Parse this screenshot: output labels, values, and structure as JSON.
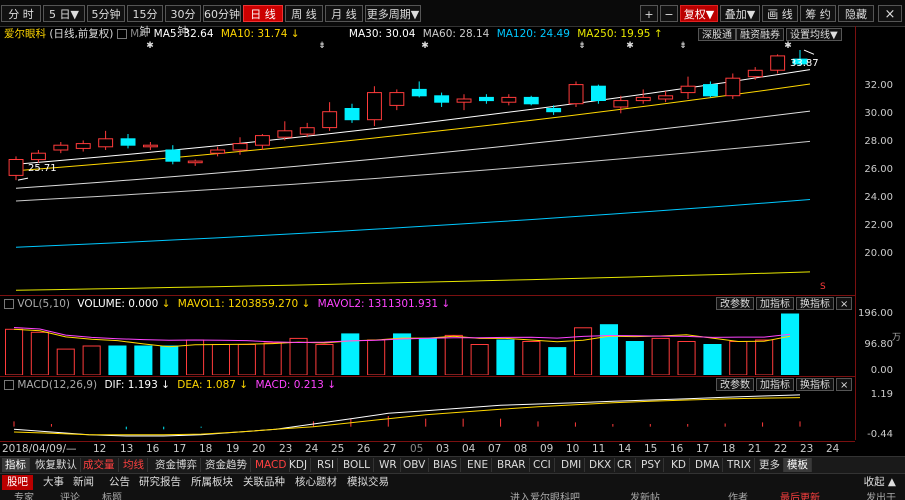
{
  "toolbar": {
    "periods": [
      "分 时",
      "5 日▼",
      "5分钟",
      "15分钟",
      "30分钟",
      "60分钟",
      "日 线",
      "周 线",
      "月 线",
      "更多周期▼"
    ],
    "active_period": "日 线",
    "right_buttons": [
      "+",
      "−",
      "复权▼",
      "叠加▼",
      "画 线",
      "筹 约",
      "隐藏"
    ],
    "close_icon": "×"
  },
  "price_panel": {
    "stock_name": "爱尔眼科",
    "mode": "(日线,前复权)",
    "ma_label": "MA",
    "ma5": "MA5: 32.64",
    "ma10": "MA10: 31.74",
    "ma30": "MA30: 30.04",
    "ma60": "MA60: 28.14",
    "ma120": "MA120: 24.49",
    "ma250": "MA250: 19.95",
    "buttons": [
      "深股通",
      "融资融券",
      "设置均线▼"
    ],
    "high_label": "33.87",
    "low_label": "25.71",
    "yaxis": [
      "32.00",
      "30.00",
      "28.00",
      "26.00",
      "24.00",
      "22.00",
      "20.00"
    ],
    "s_mark": "S"
  },
  "volume_panel": {
    "label": "VOL(5,10)",
    "volume": "VOLUME: 0.000",
    "mavol1": "MAVOL1: 1203859.270",
    "mavol2": "MAVOL2: 1311301.931",
    "buttons": [
      "改参数",
      "加指标",
      "换指标"
    ],
    "yaxis": [
      "196.00",
      "96.80",
      "0.00"
    ],
    "unit": "万"
  },
  "macd_panel": {
    "label": "MACD(12,26,9)",
    "dif": "DIF: 1.193",
    "dea": "DEA: 1.087",
    "macd": "MACD: 0.213",
    "buttons": [
      "改参数",
      "加指标",
      "换指标"
    ],
    "yaxis": [
      "1.19",
      "-0.44"
    ]
  },
  "dates": [
    "2018/04/09/—",
    "12",
    "13",
    "16",
    "17",
    "18",
    "19",
    "20",
    "23",
    "24",
    "25",
    "26",
    "27",
    "05",
    "03",
    "04",
    "07",
    "08",
    "09",
    "10",
    "11",
    "14",
    "15",
    "16",
    "17",
    "18",
    "21",
    "22",
    "23",
    "24"
  ],
  "indicator_tabs": [
    "指标",
    "恢复默认",
    "成交量",
    "均线",
    "资金博弈",
    "资金趋势",
    "MACD",
    "KDJ",
    "RSI",
    "BOLL",
    "WR",
    "OBV",
    "BIAS",
    "ENE",
    "BRAR",
    "CCI",
    "DMI",
    "DKX",
    "CR",
    "PSY",
    "KD",
    "DMA",
    "TRIX",
    "更多",
    "模板"
  ],
  "news_tabs": [
    "股吧",
    "大事",
    "新闻",
    "公告",
    "研究报告",
    "所属板块",
    "关联品种",
    "核心题材",
    "模拟交易"
  ],
  "news_right": "收起 ▲",
  "footer": [
    "专家",
    "评论",
    "标题",
    "进入爱尔眼科吧",
    "发新帖",
    "作者",
    "最后更新",
    "发出于"
  ],
  "chart_data": {
    "type": "candlestick",
    "candles": [
      {
        "o": 26.0,
        "c": 27.0,
        "h": 27.2,
        "l": 25.71
      },
      {
        "o": 27.0,
        "c": 27.4,
        "h": 27.6,
        "l": 26.8
      },
      {
        "o": 27.6,
        "c": 27.9,
        "h": 28.1,
        "l": 27.4
      },
      {
        "o": 27.7,
        "c": 28.0,
        "h": 28.2,
        "l": 27.5
      },
      {
        "o": 27.8,
        "c": 28.3,
        "h": 28.8,
        "l": 27.6
      },
      {
        "o": 28.3,
        "c": 27.9,
        "h": 28.6,
        "l": 27.7
      },
      {
        "o": 27.8,
        "c": 27.9,
        "h": 28.1,
        "l": 27.6
      },
      {
        "o": 27.6,
        "c": 26.9,
        "h": 27.9,
        "l": 26.7
      },
      {
        "o": 26.8,
        "c": 26.9,
        "h": 27.0,
        "l": 26.6
      },
      {
        "o": 27.4,
        "c": 27.6,
        "h": 27.8,
        "l": 27.2
      },
      {
        "o": 27.6,
        "c": 28.0,
        "h": 28.4,
        "l": 27.3
      },
      {
        "o": 27.9,
        "c": 28.5,
        "h": 28.6,
        "l": 27.6
      },
      {
        "o": 28.4,
        "c": 28.8,
        "h": 29.4,
        "l": 28.2
      },
      {
        "o": 28.6,
        "c": 29.0,
        "h": 29.3,
        "l": 28.4
      },
      {
        "o": 29.0,
        "c": 30.0,
        "h": 30.6,
        "l": 28.8
      },
      {
        "o": 30.2,
        "c": 29.5,
        "h": 30.5,
        "l": 29.3
      },
      {
        "o": 29.5,
        "c": 31.2,
        "h": 31.6,
        "l": 29.1
      },
      {
        "o": 30.4,
        "c": 31.2,
        "h": 31.4,
        "l": 30.1
      },
      {
        "o": 31.4,
        "c": 31.0,
        "h": 31.9,
        "l": 30.9
      },
      {
        "o": 31.0,
        "c": 30.6,
        "h": 31.2,
        "l": 30.3
      },
      {
        "o": 30.6,
        "c": 30.8,
        "h": 31.1,
        "l": 30.1
      },
      {
        "o": 30.9,
        "c": 30.7,
        "h": 31.1,
        "l": 30.5
      },
      {
        "o": 30.6,
        "c": 30.9,
        "h": 31.1,
        "l": 30.4
      },
      {
        "o": 30.9,
        "c": 30.5,
        "h": 31.0,
        "l": 30.4
      },
      {
        "o": 30.2,
        "c": 30.0,
        "h": 30.4,
        "l": 29.8
      },
      {
        "o": 30.5,
        "c": 31.7,
        "h": 31.9,
        "l": 30.3
      },
      {
        "o": 31.6,
        "c": 30.7,
        "h": 31.7,
        "l": 30.5
      },
      {
        "o": 30.3,
        "c": 30.7,
        "h": 31.0,
        "l": 29.9
      },
      {
        "o": 30.7,
        "c": 30.9,
        "h": 31.4,
        "l": 30.5
      },
      {
        "o": 30.8,
        "c": 31.0,
        "h": 31.3,
        "l": 30.6
      },
      {
        "o": 31.2,
        "c": 31.6,
        "h": 32.2,
        "l": 30.8
      },
      {
        "o": 31.7,
        "c": 31.0,
        "h": 31.9,
        "l": 30.9
      },
      {
        "o": 31.0,
        "c": 32.1,
        "h": 32.4,
        "l": 30.8
      },
      {
        "o": 32.2,
        "c": 32.6,
        "h": 32.8,
        "l": 32.0
      },
      {
        "o": 32.6,
        "c": 33.5,
        "h": 33.6,
        "l": 32.4
      },
      {
        "o": 33.3,
        "c": 33.0,
        "h": 33.87,
        "l": 32.9
      }
    ],
    "ma_lines": [
      {
        "name": "MA5",
        "color": "#ffffff",
        "start": 26.7,
        "end": 32.64
      },
      {
        "name": "MA10",
        "color": "#ffd700",
        "start": 26.3,
        "end": 31.74
      },
      {
        "name": "MA30",
        "color": "#dddddd",
        "start": 25.2,
        "end": 30.04
      },
      {
        "name": "MA60",
        "color": "#cccccc",
        "start": 24.4,
        "end": 28.14
      },
      {
        "name": "MA120",
        "color": "#00c8ff",
        "start": 21.5,
        "end": 24.49
      },
      {
        "name": "MA250",
        "color": "#e6e600",
        "start": 18.8,
        "end": 19.95
      }
    ],
    "volume": [
      150,
      140,
      85,
      95,
      95,
      95,
      95,
      115,
      100,
      100,
      105,
      120,
      100,
      135,
      115,
      135,
      120,
      130,
      100,
      115,
      110,
      90,
      155,
      165,
      110,
      120,
      110,
      100,
      110,
      115,
      200
    ],
    "volume_up": [
      true,
      true,
      true,
      true,
      false,
      false,
      false,
      true,
      true,
      true,
      true,
      true,
      true,
      false,
      true,
      false,
      false,
      true,
      true,
      false,
      true,
      false,
      true,
      false,
      false,
      true,
      true,
      false,
      true,
      true,
      false
    ],
    "macd_dif": [
      -0.1,
      -0.2,
      -0.3,
      -0.35,
      -0.35,
      -0.3,
      -0.2,
      -0.1,
      0.1,
      0.3,
      0.5,
      0.6,
      0.7,
      0.8,
      0.85,
      0.9,
      0.95,
      1.0,
      1.05,
      1.1,
      1.15,
      1.19
    ],
    "macd_dea": [
      -0.2,
      -0.25,
      -0.3,
      -0.3,
      -0.3,
      -0.28,
      -0.2,
      -0.1,
      0.0,
      0.15,
      0.3,
      0.45,
      0.55,
      0.65,
      0.75,
      0.82,
      0.9,
      0.95,
      1.0,
      1.04,
      1.07,
      1.09
    ],
    "ylim": [
      18.5,
      34.5
    ],
    "colors": {
      "up": "#ff3b3b",
      "down": "#00f0ff",
      "bg": "#000000"
    }
  }
}
